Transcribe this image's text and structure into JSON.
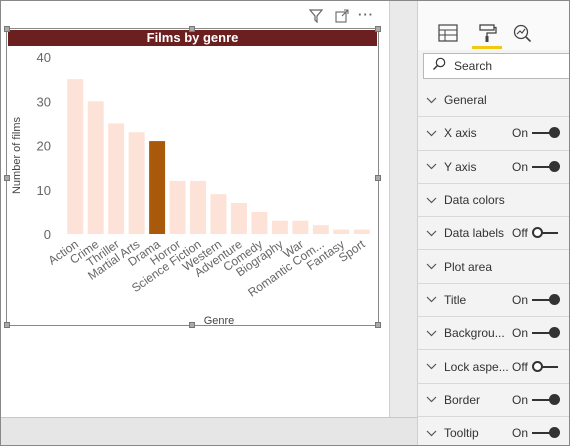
{
  "chart_data": {
    "type": "bar",
    "title": "Films by genre",
    "xlabel": "Genre",
    "ylabel": "Number of films",
    "ylim": [
      0,
      40
    ],
    "yticks": [
      "0",
      "10",
      "20",
      "30",
      "40"
    ],
    "categories": [
      "Action",
      "Crime",
      "Thriller",
      "Martial Arts",
      "Drama",
      "Horror",
      "Science Fiction",
      "Western",
      "Adventure",
      "Comedy",
      "Biography",
      "War",
      "Romantic Com...",
      "Fantasy",
      "Sport"
    ],
    "values": [
      35,
      30,
      25,
      23,
      21,
      12,
      12,
      9,
      7,
      5,
      3,
      3,
      2,
      1,
      1
    ],
    "highlighted_category": "Drama",
    "bar_color": "#fde3d7",
    "highlight_color": "#a85a0a",
    "grid": false,
    "legend": "none"
  },
  "visual_toolbar": {
    "filter_icon": "filter-icon",
    "focus_icon": "focus-mode-icon",
    "more_icon": "more-options-icon"
  },
  "colors": {
    "title_bar": "#6b1f1f",
    "accent_underline": "#f2c811"
  },
  "format_pane": {
    "tabs": [
      "fields-icon",
      "format-paint-roller-icon",
      "analytics-icon"
    ],
    "search_placeholder": "Search",
    "sections": [
      {
        "label": "General",
        "state": ""
      },
      {
        "label": "X axis",
        "state": "On"
      },
      {
        "label": "Y axis",
        "state": "On"
      },
      {
        "label": "Data colors",
        "state": ""
      },
      {
        "label": "Data labels",
        "state": "Off"
      },
      {
        "label": "Plot area",
        "state": ""
      },
      {
        "label": "Title",
        "state": "On"
      },
      {
        "label": "Backgrou...",
        "state": "On"
      },
      {
        "label": "Lock aspe...",
        "state": "Off"
      },
      {
        "label": "Border",
        "state": "On"
      },
      {
        "label": "Tooltip",
        "state": "On"
      }
    ]
  }
}
